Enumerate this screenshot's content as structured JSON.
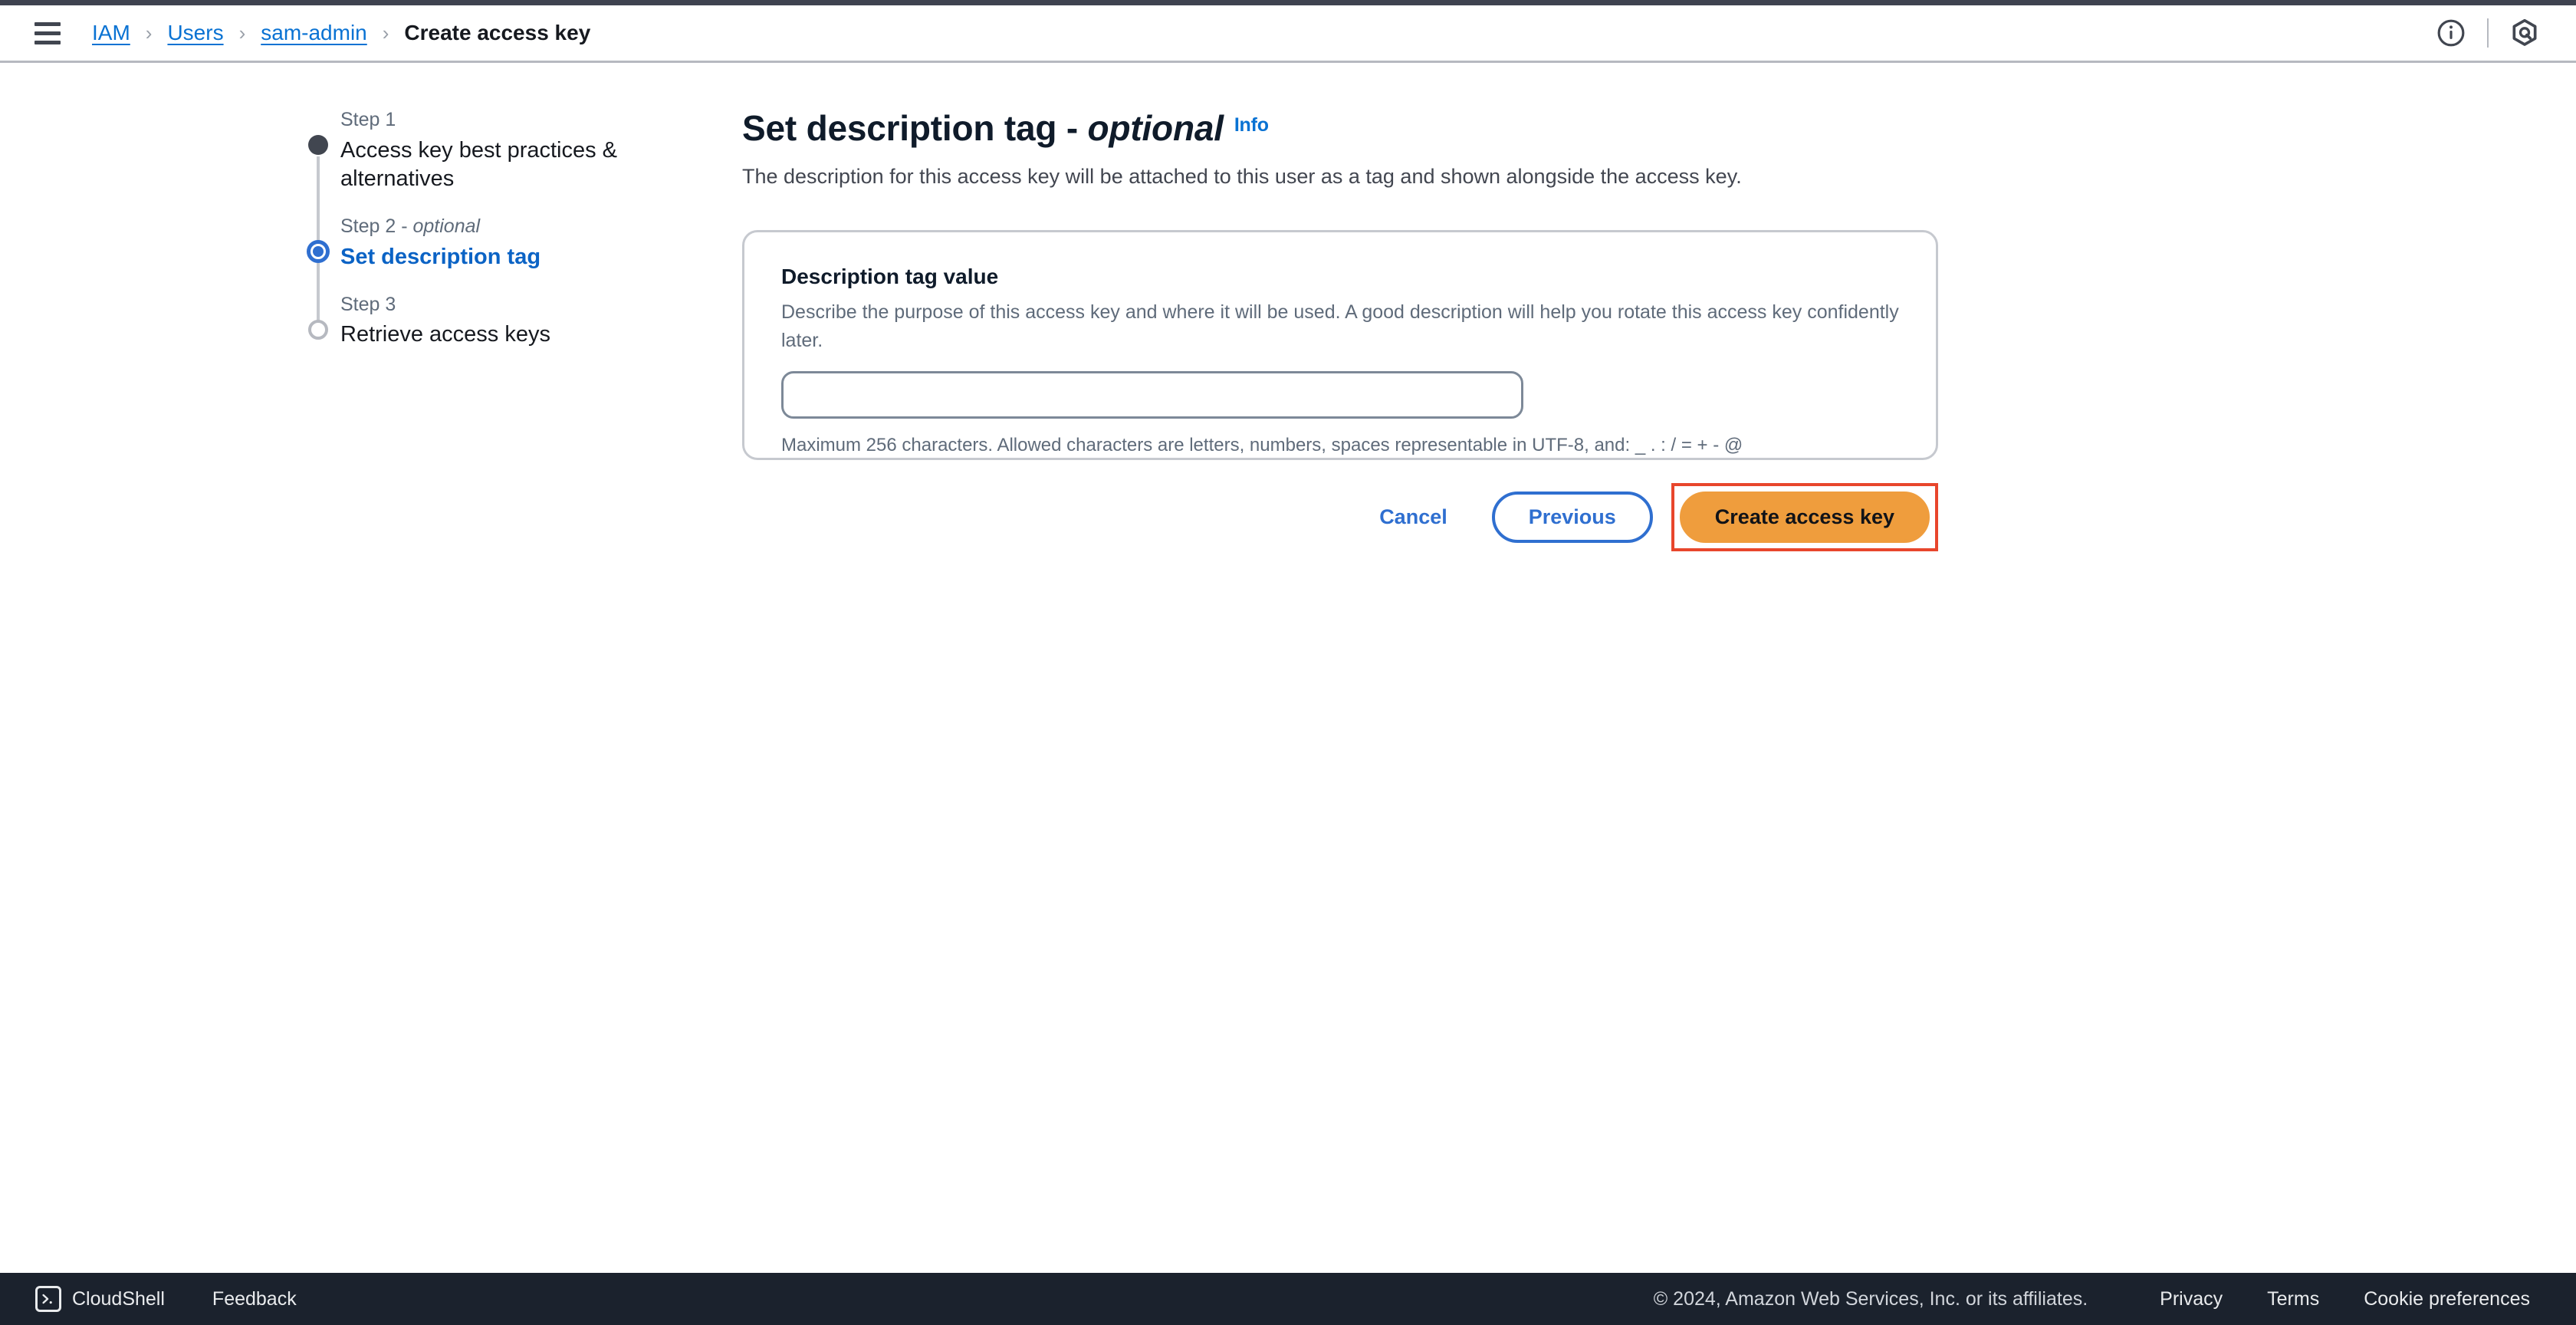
{
  "header": {
    "menu_icon": "hamburger-menu-icon",
    "breadcrumb": [
      {
        "label": "IAM",
        "link": true
      },
      {
        "label": "Users",
        "link": true
      },
      {
        "label": "sam-admin",
        "link": true
      },
      {
        "label": "Create access key",
        "link": false
      }
    ],
    "separator": "›",
    "info_icon": "info-circle-icon",
    "assistant_icon": "amazon-q-hexagon-icon"
  },
  "wizard": {
    "steps": [
      {
        "number": "Step 1",
        "optional_suffix": "",
        "title": "Access key best practices & alternatives",
        "state": "complete"
      },
      {
        "number": "Step 2 - ",
        "optional_suffix": "optional",
        "title": "Set description tag",
        "state": "current"
      },
      {
        "number": "Step 3",
        "optional_suffix": "",
        "title": "Retrieve access keys",
        "state": "upcoming"
      }
    ]
  },
  "main": {
    "title_main": "Set description tag - ",
    "title_optional": "optional",
    "info_label": "Info",
    "description": "The description for this access key will be attached to this user as a tag and shown alongside the access key."
  },
  "card": {
    "field_label": "Description tag value",
    "field_hint": "Describe the purpose of this access key and where it will be used. A good description will help you rotate this access key confidently later.",
    "input_value": "",
    "input_placeholder": "",
    "constraint": "Maximum 256 characters. Allowed characters are letters, numbers, spaces representable in UTF-8, and: _ . : / = + - @"
  },
  "actions": {
    "cancel_label": "Cancel",
    "previous_label": "Previous",
    "create_label": "Create access key"
  },
  "footer": {
    "cloudshell_label": "CloudShell",
    "cloudshell_icon": "terminal-prompt-icon",
    "feedback_label": "Feedback",
    "copyright": "© 2024, Amazon Web Services, Inc. or its affiliates.",
    "links": [
      {
        "label": "Privacy"
      },
      {
        "label": "Terms"
      },
      {
        "label": "Cookie preferences"
      }
    ]
  },
  "colors": {
    "accent_blue": "#0972d3",
    "primary_orange": "#ef9d3d",
    "highlight_red": "#e8462c",
    "footer_dark": "#1b222d",
    "top_strip": "#3f4350"
  }
}
